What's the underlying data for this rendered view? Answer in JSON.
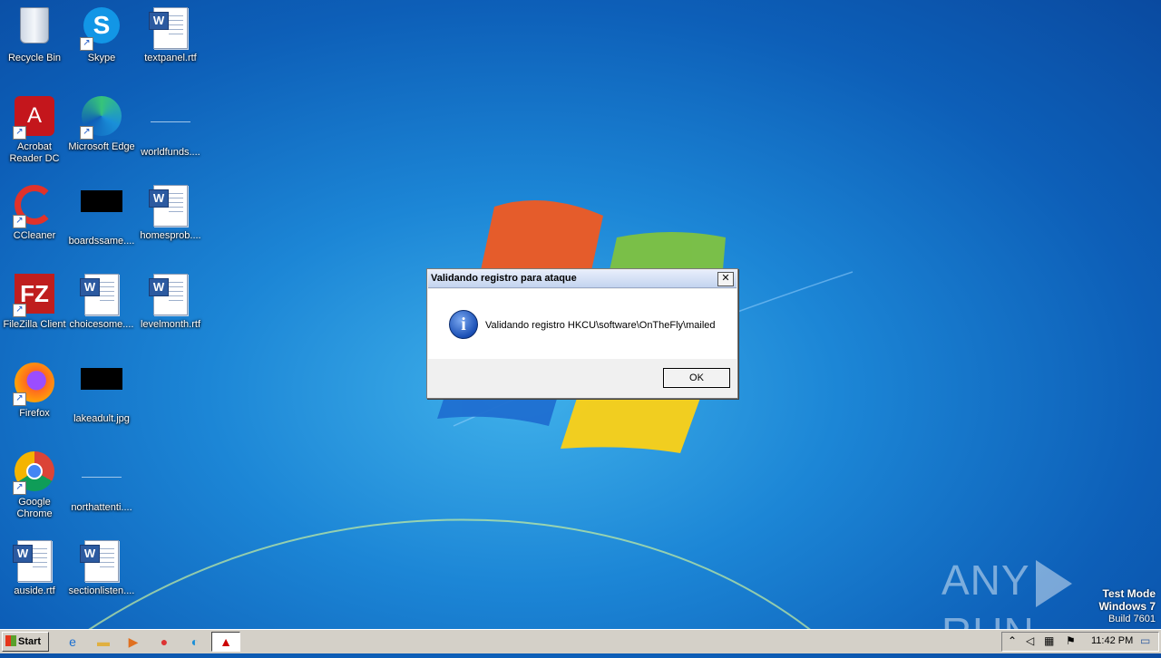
{
  "desktop_icons": [
    {
      "label": "Recycle Bin",
      "icon": "recycle-bin-icon"
    },
    {
      "label": "Skype",
      "icon": "skype-icon"
    },
    {
      "label": "textpanel.rtf",
      "icon": "word-document-icon"
    },
    {
      "label": "Acrobat Reader DC",
      "icon": "acrobat-icon"
    },
    {
      "label": "Microsoft Edge",
      "icon": "edge-icon"
    },
    {
      "label": "worldfunds....",
      "icon": "file-icon"
    },
    {
      "label": "CCleaner",
      "icon": "ccleaner-icon"
    },
    {
      "label": "boardssame....",
      "icon": "black-thumbnail-icon"
    },
    {
      "label": "homesprob....",
      "icon": "word-document-icon"
    },
    {
      "label": "FileZilla Client",
      "icon": "filezilla-icon"
    },
    {
      "label": "choicesome....",
      "icon": "word-document-icon"
    },
    {
      "label": "levelmonth.rtf",
      "icon": "word-document-icon"
    },
    {
      "label": "Firefox",
      "icon": "firefox-icon"
    },
    {
      "label": "lakeadult.jpg",
      "icon": "black-thumbnail-icon"
    },
    {
      "label": "Google Chrome",
      "icon": "chrome-icon"
    },
    {
      "label": "northattenti....",
      "icon": "file-icon"
    },
    {
      "label": "auside.rtf",
      "icon": "word-document-icon"
    },
    {
      "label": "sectionlisten....",
      "icon": "word-document-icon"
    }
  ],
  "dialog": {
    "title": "Validando registro para ataque",
    "close_glyph": "✕",
    "message": "Validando registro HKCU\\software\\OnTheFly\\mailed",
    "ok_label": "OK"
  },
  "watermark": {
    "left": "ANY",
    "right": "RUN"
  },
  "test_mode": {
    "line1": "Test Mode",
    "line2": "Windows 7",
    "line3": "Build 7601"
  },
  "taskbar": {
    "start_label": "Start",
    "clock": "11:42 PM"
  },
  "colors": {
    "accent": "#1c86d6",
    "taskbar": "#d4d0c8"
  }
}
